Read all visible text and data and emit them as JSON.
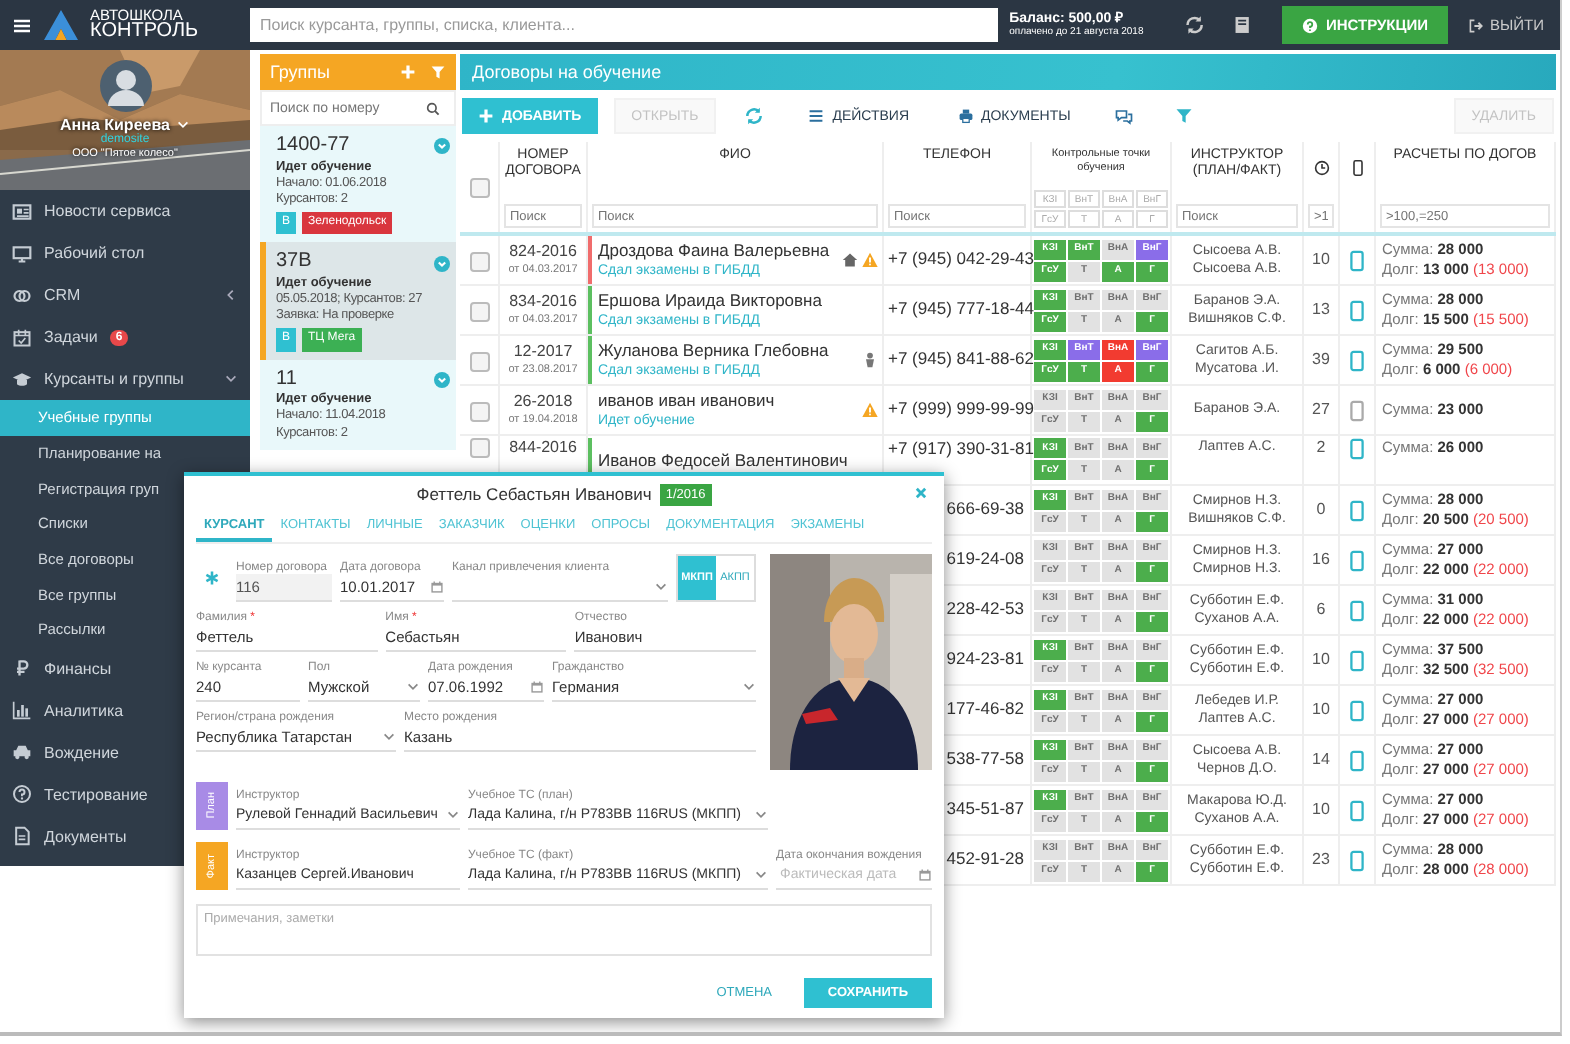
{
  "logo": {
    "line_1": "АВТОШКОЛА",
    "line_2": "КОНТРОЛЬ"
  },
  "topbar": {
    "search": {
      "placeholder": "Поиск курсанта, группы, списка, клиента..."
    },
    "balance": "Баланс: 500,00 ₽",
    "paid_until": "оплачено до 21 августа 2018",
    "help_button": "ИНСТРУКЦИИ",
    "logout": "ВЫЙТИ"
  },
  "profile": {
    "name": "Анна Киреева",
    "login": "demosite",
    "company": "ООО \"Пятое колесо\""
  },
  "menu": [
    {
      "label": "Новости сервиса",
      "selected": false
    },
    {
      "label": "Рабочий стол",
      "selected": false
    },
    {
      "label": "CRM",
      "selected": false,
      "expanded": false
    },
    {
      "label": "Задачи",
      "selected": false,
      "badge": "6"
    },
    {
      "label": "Курсанты и группы",
      "selected": false,
      "expanded": true,
      "children": [
        {
          "label": "Учебные группы",
          "selected": true
        },
        {
          "label": "Планирование на",
          "selected": false
        },
        {
          "label": "Регистрация груп",
          "selected": false
        },
        {
          "label": "Списки",
          "selected": false
        },
        {
          "label": "Все договоры",
          "selected": false
        },
        {
          "label": "Все группы",
          "selected": false
        },
        {
          "label": "Рассылки",
          "selected": false
        }
      ]
    },
    {
      "label": "Финансы",
      "selected": false
    },
    {
      "label": "Аналитика",
      "selected": false
    },
    {
      "label": "Вождение",
      "selected": false
    },
    {
      "label": "Тестирование",
      "selected": false
    },
    {
      "label": "Документы",
      "selected": false
    }
  ],
  "groups": {
    "title": "Группы",
    "search": {
      "placeholder": "Поиск по номеру"
    },
    "items": [
      {
        "number": "1400-77",
        "selected": false,
        "status": "Идет обучение",
        "lines": [
          "Начало: 01.06.2018",
          "Курсантов: 2"
        ],
        "tags": [
          {
            "label": "В",
            "color": "#2fc0d1"
          },
          {
            "label": "Зеленодольск",
            "color": "#d9363e"
          }
        ]
      },
      {
        "number": "37В",
        "selected": true,
        "status": "Идет обучение",
        "lines": [
          "05.05.2018; Курсантов: 27",
          "Заявка: На проверке"
        ],
        "tags": [
          {
            "label": "В",
            "color": "#2fc0d1"
          },
          {
            "label": "ТЦ Мега",
            "color": "#3cb054"
          }
        ]
      },
      {
        "number": "11",
        "selected": false,
        "status": "Идет обучение",
        "lines": [
          "Начало: 11.04.2018",
          "Курсантов: 2"
        ]
      }
    ]
  },
  "contracts": {
    "title": "Договоры на обучение",
    "toolbar": [
      {
        "kind": "add",
        "label": "ДОБАВИТЬ",
        "disabled": false
      },
      {
        "kind": "plain",
        "label": "ОТКРЫТЬ",
        "disabled": true
      },
      {
        "kind": "refresh",
        "disabled": false
      },
      {
        "kind": "actions",
        "label": "ДЕЙСТВИЯ",
        "disabled": false
      },
      {
        "kind": "print",
        "label": "ДОКУМЕНТЫ",
        "disabled": false
      },
      {
        "kind": "chat",
        "disabled": false
      },
      {
        "kind": "filter",
        "disabled": false
      },
      {
        "kind": "plain",
        "label": "УДАЛИТЬ",
        "disabled": true
      }
    ],
    "all_checked": false,
    "columns": {
      "number": {
        "label": "НОМЕР ДОГОВОРА",
        "filter_placeholder": "Поиск"
      },
      "name": {
        "label": "ФИО",
        "filter_placeholder": "Поиск"
      },
      "phone": {
        "label": "ТЕЛЕФОН",
        "filter_placeholder": "Поиск"
      },
      "points": {
        "label": "Контрольные точки обучения",
        "filters": [
          "КЗI",
          "ВнТ",
          "ВнА",
          "ВнГ",
          "ГсУ",
          "Т",
          "А",
          "Г"
        ]
      },
      "instructor": {
        "label": "ИНСТРУКТОР (ПЛАН/ФАКТ)",
        "filter_placeholder": "Поиск"
      },
      "hours": {
        "filter_placeholder": ">1"
      },
      "payments": {
        "label": "РАСЧЕТЫ ПО ДОГОВ",
        "filter_placeholder": ">100,=250"
      }
    },
    "rows": [
      {
        "kind": "full",
        "checked": false,
        "number": "824-2016",
        "date": "от 04.03.2017",
        "name": "Дроздова Фаина Валерьевна",
        "status": "Сдал экзамены в ГИБДД",
        "color": "#f06c6c",
        "home": true,
        "person": false,
        "warning": true,
        "phone": "+7 (945) 042-29-43",
        "points": [
          {
            "label": "КЗI",
            "color": "#4cae4c"
          },
          {
            "label": "ВнТ",
            "color": "#4cae4c"
          },
          {
            "label": "ВнА",
            "color": "#e2e2e2"
          },
          {
            "label": "ВнГ",
            "color": "#8a6de9"
          },
          {
            "label": "ГсУ",
            "color": "#4cae4c"
          },
          {
            "label": "Т",
            "color": "#e2e2e2"
          },
          {
            "label": "А",
            "color": "#4cae4c"
          },
          {
            "label": "Г",
            "color": "#4cae4c"
          }
        ],
        "instructor_plan": "Сысоева А.В.",
        "instructor_fact": "Сысоева А.В.",
        "hours": "10",
        "app": true,
        "sum": "Сумма: **28 000**",
        "debt": "Долг: **13 000**",
        "debt_rest": "(13 000)"
      },
      {
        "kind": "full",
        "checked": false,
        "number": "834-2016",
        "date": "от 04.03.2017",
        "name": "Ершова Ираида Викторовна",
        "status": "Сдал экзамены в ГИБДД",
        "color": "#5cbf60",
        "home": false,
        "person": false,
        "warning": false,
        "phone": "+7 (945) 777-18-44",
        "points": [
          {
            "label": "КЗI",
            "color": "#4cae4c"
          },
          {
            "label": "ВнТ",
            "color": "#e2e2e2"
          },
          {
            "label": "ВнА",
            "color": "#e2e2e2"
          },
          {
            "label": "ВнГ",
            "color": "#e2e2e2"
          },
          {
            "label": "ГсУ",
            "color": "#4cae4c"
          },
          {
            "label": "Т",
            "color": "#e2e2e2"
          },
          {
            "label": "А",
            "color": "#e2e2e2"
          },
          {
            "label": "Г",
            "color": "#4cae4c"
          }
        ],
        "instructor_plan": "Баранов Э.А.",
        "instructor_fact": "Вишняков С.Ф.",
        "hours": "13",
        "app": true,
        "sum": "Сумма: **28 000**",
        "debt": "Долг: **15 500**",
        "debt_rest": "(15 500)"
      },
      {
        "kind": "full",
        "checked": false,
        "number": "12-2017",
        "date": "от 23.08.2017",
        "name": "Жуланова Верника Глебовна",
        "status": "Сдал экзамены в ГИБДД",
        "color": "#5cbf60",
        "home": false,
        "person": true,
        "warning": false,
        "phone": "+7 (945) 841-88-62",
        "points": [
          {
            "label": "КЗI",
            "color": "#4cae4c"
          },
          {
            "label": "ВнТ",
            "color": "#8a6de9"
          },
          {
            "label": "ВнА",
            "color": "#f23b30"
          },
          {
            "label": "ВнГ",
            "color": "#8a6de9"
          },
          {
            "label": "ГсУ",
            "color": "#4cae4c"
          },
          {
            "label": "Т",
            "color": "#4cae4c"
          },
          {
            "label": "А",
            "color": "#f23b30"
          },
          {
            "label": "Г",
            "color": "#4cae4c"
          }
        ],
        "instructor_plan": "Сагитов А.Б.",
        "instructor_fact": "Мусатова .И.",
        "hours": "39",
        "app": true,
        "sum": "Сумма: **29 500**",
        "debt": "Долг: **6 000**",
        "debt_rest": "(6 000)"
      },
      {
        "kind": "full",
        "checked": false,
        "number": "26-2018",
        "date": "от 19.04.2018",
        "name": "иванов иван иванович",
        "status": "Идет обучение",
        "home": false,
        "person": false,
        "warning": true,
        "phone": "+7 (999) 999-99-99",
        "points": [
          {
            "label": "КЗI",
            "color": "#e2e2e2"
          },
          {
            "label": "ВнТ",
            "color": "#e2e2e2"
          },
          {
            "label": "ВнА",
            "color": "#e2e2e2"
          },
          {
            "label": "ВнГ",
            "color": "#e2e2e2"
          },
          {
            "label": "ГсУ",
            "color": "#e2e2e2"
          },
          {
            "label": "Т",
            "color": "#e2e2e2"
          },
          {
            "label": "А",
            "color": "#e2e2e2"
          },
          {
            "label": "Г",
            "color": "#4cae4c"
          }
        ],
        "instructor_plan": "Баранов Э.А.",
        "hours": "27",
        "app": false,
        "sum": "Сумма: **23 000**"
      },
      {
        "kind": "full",
        "checked": false,
        "number": "844-2016",
        "name": "Иванов Федосей Валентинович",
        "color": "#5cbf60",
        "phone": "+7 (917) 390-31-81",
        "points": [
          {
            "label": "КЗI",
            "color": "#4cae4c"
          },
          {
            "label": "ВнТ",
            "color": "#e2e2e2"
          },
          {
            "label": "ВнА",
            "color": "#e2e2e2"
          },
          {
            "label": "ВнГ",
            "color": "#e2e2e2"
          },
          {
            "label": "ГсУ",
            "color": "#4cae4c"
          },
          {
            "label": "Т",
            "color": "#e2e2e2"
          },
          {
            "label": "А",
            "color": "#e2e2e2"
          },
          {
            "label": "Г",
            "color": "#4cae4c"
          }
        ],
        "instructor_plan": "Лаптев А.С.",
        "hours": "2",
        "app": true,
        "sum": "Сумма: **26 000**"
      },
      {
        "kind": "covered",
        "phone": "666-69-38",
        "points": [
          {
            "label": "КЗI",
            "color": "#4cae4c"
          },
          {
            "label": "ВнТ",
            "color": "#e2e2e2"
          },
          {
            "label": "ВнА",
            "color": "#e2e2e2"
          },
          {
            "label": "ВнГ",
            "color": "#e2e2e2"
          },
          {
            "label": "ГсУ",
            "color": "#e2e2e2"
          },
          {
            "label": "Т",
            "color": "#e2e2e2"
          },
          {
            "label": "А",
            "color": "#e2e2e2"
          },
          {
            "label": "Г",
            "color": "#4cae4c"
          }
        ],
        "instructor_plan": "Смирнов Н.З.",
        "instructor_fact": "Вишняков С.Ф.",
        "hours": "0",
        "app": true,
        "sum": "Сумма: **28 000**",
        "debt": "Долг: **20 500**",
        "debt_rest": "(20 500)"
      },
      {
        "kind": "covered",
        "phone": "619-24-08",
        "points": [
          {
            "label": "КЗI",
            "color": "#e2e2e2"
          },
          {
            "label": "ВнТ",
            "color": "#e2e2e2"
          },
          {
            "label": "ВнА",
            "color": "#e2e2e2"
          },
          {
            "label": "ВнГ",
            "color": "#e2e2e2"
          },
          {
            "label": "ГсУ",
            "color": "#e2e2e2"
          },
          {
            "label": "Т",
            "color": "#e2e2e2"
          },
          {
            "label": "А",
            "color": "#e2e2e2"
          },
          {
            "label": "Г",
            "color": "#4cae4c"
          }
        ],
        "instructor_plan": "Смирнов Н.З.",
        "instructor_fact": "Смирнов Н.З.",
        "hours": "16",
        "app": true,
        "sum": "Сумма: **27 000**",
        "debt": "Долг: **22 000**",
        "debt_rest": "(22 000)"
      },
      {
        "kind": "covered",
        "phone": "228-42-53",
        "points": [
          {
            "label": "КЗI",
            "color": "#e2e2e2"
          },
          {
            "label": "ВнТ",
            "color": "#e2e2e2"
          },
          {
            "label": "ВнА",
            "color": "#e2e2e2"
          },
          {
            "label": "ВнГ",
            "color": "#e2e2e2"
          },
          {
            "label": "ГсУ",
            "color": "#e2e2e2"
          },
          {
            "label": "Т",
            "color": "#e2e2e2"
          },
          {
            "label": "А",
            "color": "#e2e2e2"
          },
          {
            "label": "Г",
            "color": "#4cae4c"
          }
        ],
        "instructor_plan": "Субботин Е.Ф.",
        "instructor_fact": "Суханов А.А.",
        "hours": "6",
        "app": true,
        "sum": "Сумма: **31 000**",
        "debt": "Долг: **22 000**",
        "debt_rest": "(22 000)"
      },
      {
        "kind": "covered",
        "phone": "924-23-81",
        "points": [
          {
            "label": "КЗI",
            "color": "#4cae4c"
          },
          {
            "label": "ВнТ",
            "color": "#e2e2e2"
          },
          {
            "label": "ВнА",
            "color": "#e2e2e2"
          },
          {
            "label": "ВнГ",
            "color": "#e2e2e2"
          },
          {
            "label": "ГсУ",
            "color": "#e2e2e2"
          },
          {
            "label": "Т",
            "color": "#e2e2e2"
          },
          {
            "label": "А",
            "color": "#e2e2e2"
          },
          {
            "label": "Г",
            "color": "#4cae4c"
          }
        ],
        "instructor_plan": "Субботин Е.Ф.",
        "instructor_fact": "Субботин Е.Ф.",
        "hours": "10",
        "app": true,
        "sum": "Сумма: **37 500**",
        "debt": "Долг: **32 500**",
        "debt_rest": "(32 500)"
      },
      {
        "kind": "covered",
        "phone": "177-46-82",
        "points": [
          {
            "label": "КЗI",
            "color": "#4cae4c"
          },
          {
            "label": "ВнТ",
            "color": "#e2e2e2"
          },
          {
            "label": "ВнА",
            "color": "#e2e2e2"
          },
          {
            "label": "ВнГ",
            "color": "#e2e2e2"
          },
          {
            "label": "ГсУ",
            "color": "#e2e2e2"
          },
          {
            "label": "Т",
            "color": "#e2e2e2"
          },
          {
            "label": "А",
            "color": "#e2e2e2"
          },
          {
            "label": "Г",
            "color": "#4cae4c"
          }
        ],
        "instructor_plan": "Лебедев И.Р.",
        "instructor_fact": "Лаптев А.С.",
        "hours": "10",
        "app": true,
        "sum": "Сумма: **27 000**",
        "debt": "Долг: **27 000**",
        "debt_rest": "(27 000)"
      },
      {
        "kind": "covered",
        "phone": "538-77-58",
        "points": [
          {
            "label": "КЗI",
            "color": "#4cae4c"
          },
          {
            "label": "ВнТ",
            "color": "#e2e2e2"
          },
          {
            "label": "ВнА",
            "color": "#e2e2e2"
          },
          {
            "label": "ВнГ",
            "color": "#e2e2e2"
          },
          {
            "label": "ГсУ",
            "color": "#e2e2e2"
          },
          {
            "label": "Т",
            "color": "#e2e2e2"
          },
          {
            "label": "А",
            "color": "#e2e2e2"
          },
          {
            "label": "Г",
            "color": "#4cae4c"
          }
        ],
        "instructor_plan": "Сысоева А.В.",
        "instructor_fact": "Чернов Д.О.",
        "hours": "14",
        "app": true,
        "sum": "Сумма: **27 000**",
        "debt": "Долг: **27 000**",
        "debt_rest": "(27 000)"
      },
      {
        "kind": "covered",
        "phone": "345-51-87",
        "points": [
          {
            "label": "КЗI",
            "color": "#4cae4c"
          },
          {
            "label": "ВнТ",
            "color": "#e2e2e2"
          },
          {
            "label": "ВнА",
            "color": "#e2e2e2"
          },
          {
            "label": "ВнГ",
            "color": "#e2e2e2"
          },
          {
            "label": "ГсУ",
            "color": "#e2e2e2"
          },
          {
            "label": "Т",
            "color": "#e2e2e2"
          },
          {
            "label": "А",
            "color": "#e2e2e2"
          },
          {
            "label": "Г",
            "color": "#4cae4c"
          }
        ],
        "instructor_plan": "Макарова Ю.Д.",
        "instructor_fact": "Суханов А.А.",
        "hours": "10",
        "app": true,
        "sum": "Сумма: **27 000**",
        "debt": "Долг: **27 000**",
        "debt_rest": "(27 000)"
      },
      {
        "kind": "covered",
        "phone": "452-91-28",
        "points": [
          {
            "label": "КЗI",
            "color": "#e2e2e2"
          },
          {
            "label": "ВнТ",
            "color": "#e2e2e2"
          },
          {
            "label": "ВнА",
            "color": "#e2e2e2"
          },
          {
            "label": "ВнГ",
            "color": "#e2e2e2"
          },
          {
            "label": "ГсУ",
            "color": "#e2e2e2"
          },
          {
            "label": "Т",
            "color": "#e2e2e2"
          },
          {
            "label": "А",
            "color": "#e2e2e2"
          },
          {
            "label": "Г",
            "color": "#4cae4c"
          }
        ],
        "instructor_plan": "Субботин Е.Ф.",
        "instructor_fact": "Субботин Е.Ф.",
        "hours": "23",
        "app": true,
        "sum": "Сумма: **28 000**",
        "debt": "Долг: **28 000**",
        "debt_rest": "(28 000)"
      }
    ]
  },
  "dialog": {
    "title": "Феттель Себастьян Иванович",
    "badge": "1/2016",
    "tabs": [
      {
        "label": "КУРСАНТ",
        "selected": true
      },
      {
        "label": "КОНТАКТЫ",
        "selected": false
      },
      {
        "label": "ЛИЧНЫЕ",
        "selected": false
      },
      {
        "label": "ЗАКАЗЧИК",
        "selected": false
      },
      {
        "label": "ОЦЕНКИ",
        "selected": false
      },
      {
        "label": "ОПРОСЫ",
        "selected": false
      },
      {
        "label": "ДОКУМЕНТАЦИЯ",
        "selected": false
      },
      {
        "label": "ЭКЗАМЕНЫ",
        "selected": false
      }
    ],
    "form_rows": [
      [
        {
          "kind": "text",
          "label": "Номер договора",
          "value": "116",
          "disabled": true
        },
        {
          "kind": "date",
          "label": "Дата договора",
          "value": "10.01.2017",
          "disabled": false
        },
        {
          "kind": "select",
          "label": "Канал привлечения клиента",
          "disabled": false
        }
      ],
      [
        {
          "kind": "text",
          "label": "Фамилия",
          "required_mark": "*",
          "value": "Феттель",
          "disabled": false
        },
        {
          "kind": "text",
          "label": "Имя",
          "required_mark": "*",
          "value": "Себастьян",
          "disabled": false
        },
        {
          "kind": "text",
          "label": "Отчество",
          "value": "Иванович",
          "disabled": false
        }
      ],
      [
        {
          "kind": "text",
          "label": "№ курсанта",
          "value": "240",
          "disabled": false
        },
        {
          "kind": "select",
          "label": "Пол",
          "value": "Мужской",
          "disabled": false
        },
        {
          "kind": "date",
          "label": "Дата рождения",
          "value": "07.06.1992",
          "disabled": false
        },
        {
          "kind": "select",
          "label": "Гражданство",
          "value": "Германия",
          "disabled": false
        }
      ],
      [
        {
          "kind": "select",
          "label": "Регион/страна рождения",
          "value": "Республика Татарстан",
          "disabled": false
        },
        {
          "kind": "text",
          "label": "Место рождения",
          "value": "Казань",
          "disabled": false
        }
      ]
    ],
    "gearbox": [
      {
        "label": "МКПП",
        "selected": true
      },
      {
        "label": "АКПП",
        "selected": false
      }
    ],
    "photo": {
      "kind": "picture"
    },
    "assignments": [
      {
        "tag": "План",
        "color": "#a88be6",
        "fields": [
          {
            "kind": "select",
            "label": "Инструктор",
            "value": "Рулевой Геннадий Васильевич"
          },
          {
            "kind": "select",
            "label": "Учебное ТС (план)",
            "value": "Лада Калина, г/н Р783ВВ 116RUS (МКПП)"
          }
        ]
      },
      {
        "tag": "Факт",
        "color": "#f5a623",
        "fields": [
          {
            "kind": "text",
            "label": "Инструктор",
            "value": "Казанцев Сергей.Иванович"
          },
          {
            "kind": "select",
            "label": "Учебное ТС (факт)",
            "value": "Лада Калина, г/н Р783ВВ 116RUS (МКПП)"
          },
          {
            "kind": "date",
            "label": "Дата окончания вождения",
            "placeholder": "Фактическая дата"
          }
        ]
      }
    ],
    "notes": {
      "placeholder": "Примечания, заметки"
    },
    "cancel": "ОТМЕНА",
    "save": "СОХРАНИТЬ"
  }
}
